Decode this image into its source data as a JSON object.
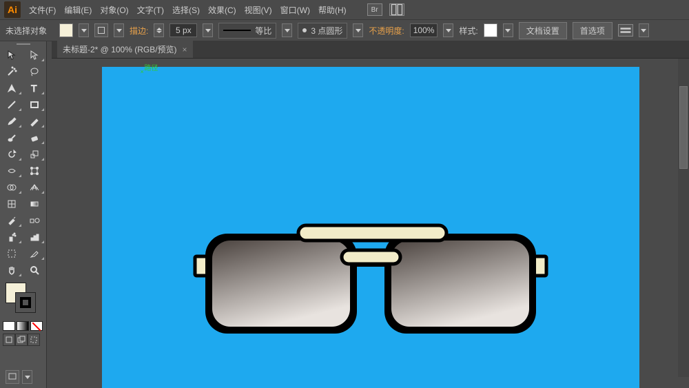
{
  "menu": {
    "items": [
      "文件(F)",
      "编辑(E)",
      "对象(O)",
      "文字(T)",
      "选择(S)",
      "效果(C)",
      "视图(V)",
      "窗口(W)",
      "帮助(H)"
    ]
  },
  "control": {
    "selection": "未选择对象",
    "stroke_label": "描边:",
    "stroke_value": "5 px",
    "profile_label": "等比",
    "brush_label": "3 点圆形",
    "opacity_label": "不透明度:",
    "opacity_value": "100%",
    "style_label": "样式:",
    "docsetup": "文档设置",
    "prefs": "首选项"
  },
  "tab": {
    "title": "未标题-2* @ 100% (RGB/预览)"
  },
  "artboard": {
    "path_label": "路径"
  },
  "logo": "Ai"
}
